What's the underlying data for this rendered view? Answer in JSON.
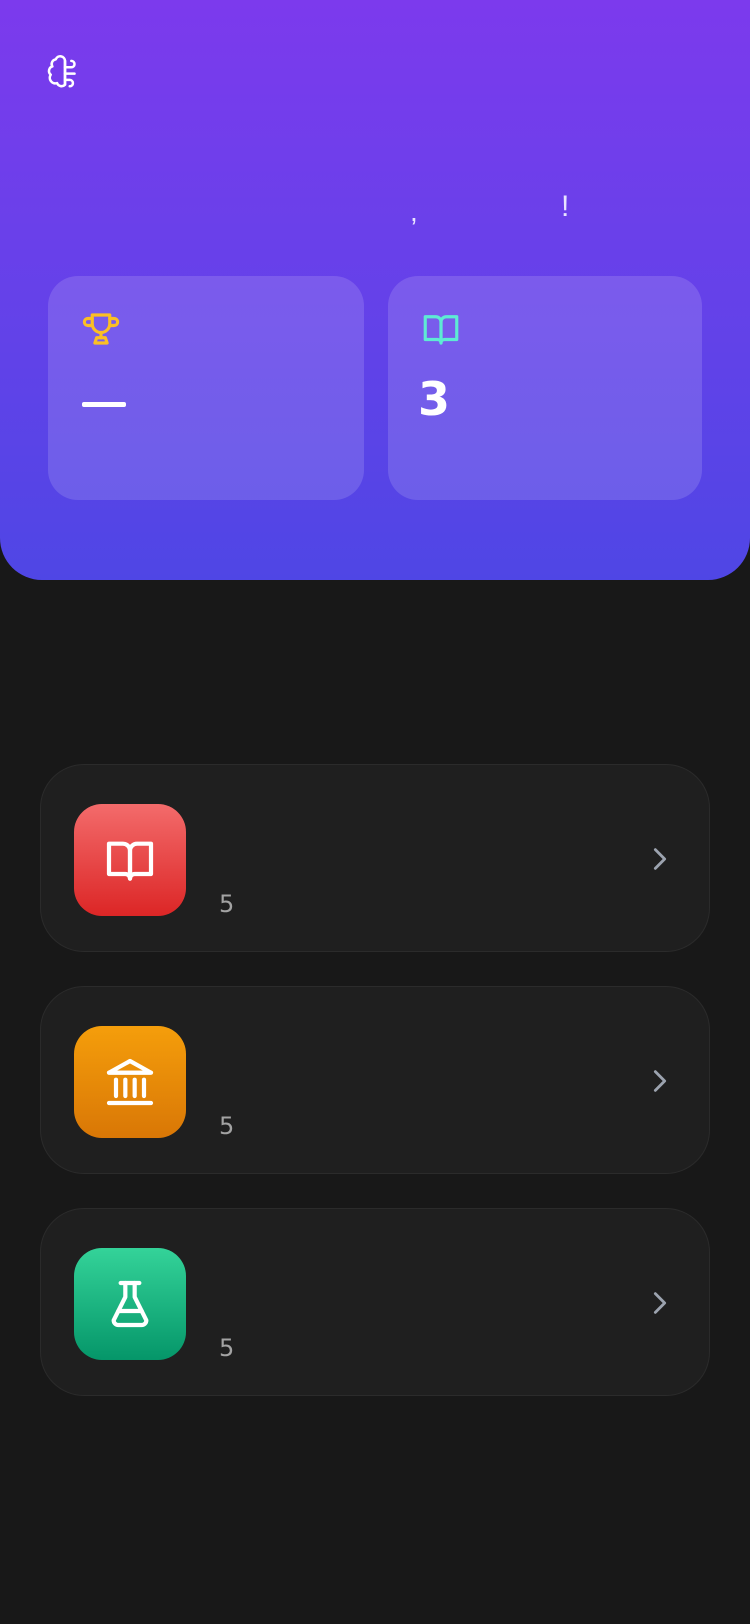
{
  "header": {
    "greeting_comma": ",",
    "greeting_exclaim": "!"
  },
  "stats": [
    {
      "icon": "trophy-icon",
      "value": "",
      "icon_color": "#fbbf24"
    },
    {
      "icon": "book-open-icon",
      "value": "3",
      "icon_color": "#5eead4"
    }
  ],
  "categories": [
    {
      "icon": "book-open-icon",
      "count": "5",
      "color": "#dc2626"
    },
    {
      "icon": "bank-icon",
      "count": "5",
      "color": "#d97706"
    },
    {
      "icon": "flask-icon",
      "count": "5",
      "color": "#059669"
    }
  ],
  "colors": {
    "header_gradient_top": "#7c3aed",
    "header_gradient_bottom": "#4f46e5",
    "background": "#181818",
    "card": "#1f1f1f"
  }
}
